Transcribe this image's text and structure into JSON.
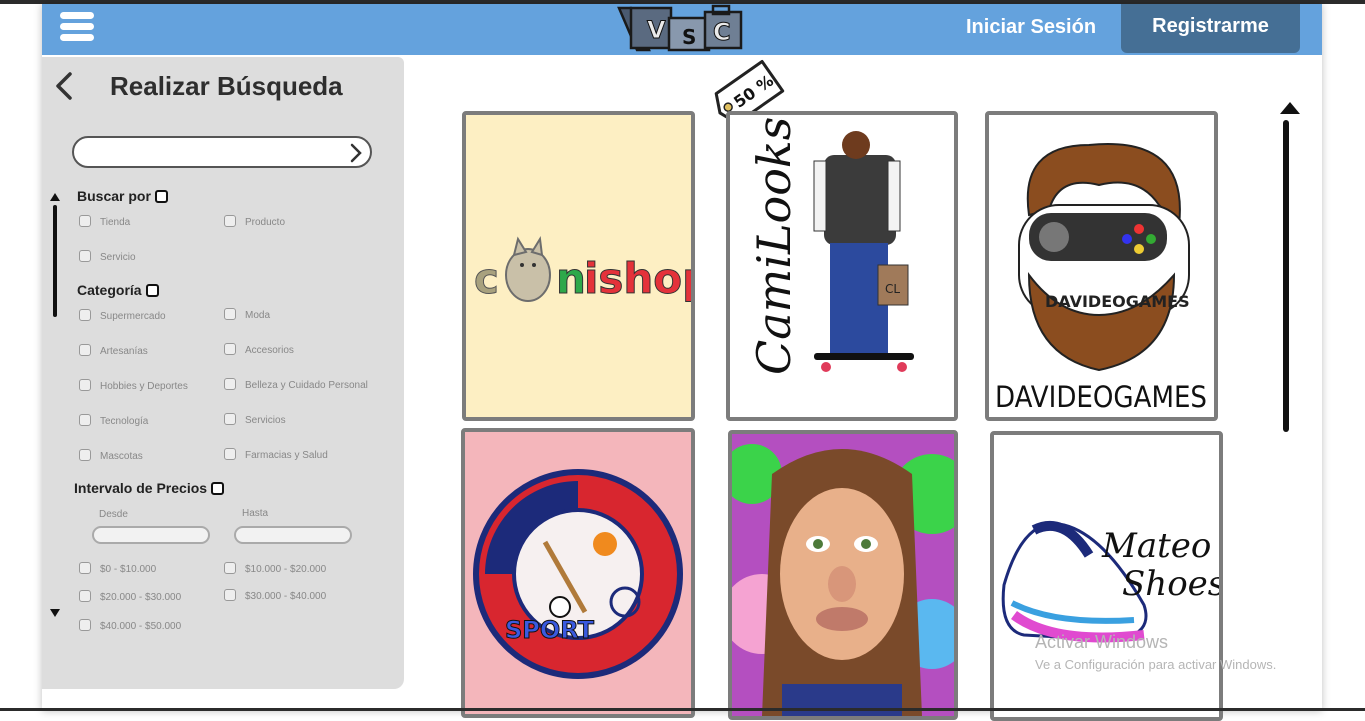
{
  "header": {
    "login_label": "Iniciar Sesión",
    "register_label": "Registrarme",
    "logo_letters": [
      "V",
      "S",
      "C"
    ]
  },
  "sidebar": {
    "title": "Realizar Búsqueda",
    "search_value": "",
    "sections": {
      "buscar_por": "Buscar por",
      "categoria": "Categoría",
      "precios": "Intervalo de Precios"
    },
    "buscar_por_options": [
      "Tienda",
      "Producto",
      "Servicio"
    ],
    "categoria_options": [
      "Supermercado",
      "Moda",
      "Artesanías",
      "Accesorios",
      "Hobbies y Deportes",
      "Belleza y Cuidado Personal",
      "Tecnología",
      "Servicios",
      "Mascotas",
      "Farmacias y Salud"
    ],
    "desde_label": "Desde",
    "hasta_label": "Hasta",
    "price_options": [
      "$0 - $10.000",
      "$10.000 - $20.000",
      "$20.000 - $30.000",
      "$30.000 - $40.000",
      "$40.000 - $50.000"
    ]
  },
  "discount_tag": "50 %",
  "stores": {
    "canishop": "Canishop",
    "camilooks": "CamiLooks",
    "davideogames_logo": "DAVIDEOGAMES",
    "davideogames": "DAVIDEOGAMES",
    "sport": "SPORT",
    "mateo_line1": "Mateo",
    "mateo_line2": "Shoes"
  },
  "watermark": {
    "line1": "Activar Windows",
    "line2": "Ve a Configuración para activar Windows."
  },
  "colors": {
    "header": "#64a2dd",
    "register_button": "#456f95",
    "sidebar": "#dddddd",
    "card_border": "#7c7c7c"
  }
}
